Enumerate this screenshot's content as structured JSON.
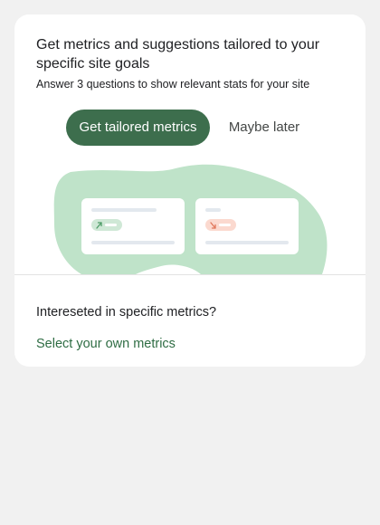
{
  "card": {
    "headline": "Get metrics and suggestions tailored to your specific site goals",
    "subtext": "Answer 3 questions to show relevant stats for your site",
    "primary_button_label": "Get tailored metrics",
    "secondary_button_label": "Maybe later",
    "illustration": {
      "cards": [
        {
          "trend": "up",
          "icon": "trend-up-icon",
          "badge_color": "#cfe8d6",
          "icon_color": "#4f9d68"
        },
        {
          "trend": "down",
          "icon": "trend-down-icon",
          "badge_color": "#fbd9cf",
          "icon_color": "#e0765a"
        }
      ],
      "blob_color": "#bfe3c9"
    }
  },
  "custom_section": {
    "question": "Intereseted in specific metrics?",
    "link_label": "Select your own metrics"
  },
  "colors": {
    "accent": "#3d6e4d",
    "link": "#2f6d44",
    "page_background": "#f1f1f1"
  }
}
